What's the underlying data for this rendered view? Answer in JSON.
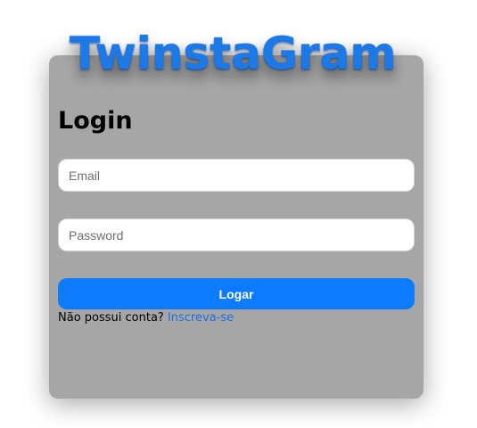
{
  "brand": {
    "logo_text": "TwinstaGram"
  },
  "login": {
    "title": "Login",
    "email_placeholder": "Email",
    "password_placeholder": "Password",
    "submit_label": "Logar",
    "signup_prompt": "Não possui conta?",
    "signup_link": "Inscreva-se"
  },
  "colors": {
    "card_background": "#a6a6a6",
    "primary_button": "#0d7bff",
    "logo": "#1b79e8",
    "link": "#1b6fe0"
  }
}
